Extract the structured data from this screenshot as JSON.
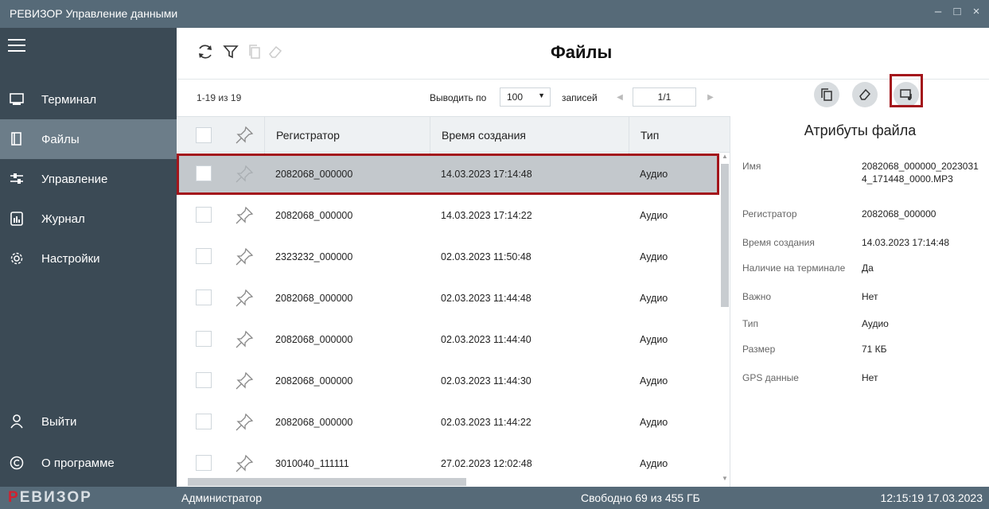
{
  "window": {
    "title": "РЕВИЗОР Управление данными",
    "min": "–",
    "max": "□",
    "close": "×"
  },
  "sidebar": {
    "items": [
      {
        "label": "Терминал",
        "icon": "terminal-icon"
      },
      {
        "label": "Файлы",
        "icon": "files-icon",
        "active": true
      },
      {
        "label": "Управление",
        "icon": "sliders-icon"
      },
      {
        "label": "Журнал",
        "icon": "journal-icon"
      },
      {
        "label": "Настройки",
        "icon": "gear-icon"
      }
    ],
    "bottom": [
      {
        "label": "Выйти",
        "icon": "user-icon"
      },
      {
        "label": "О программе",
        "icon": "copyright-icon"
      }
    ]
  },
  "toolbar": {
    "title": "Файлы"
  },
  "list": {
    "count": "1-19 из 19",
    "per_page_label": "Выводить по",
    "per_page_value": "100",
    "records_label": "записей",
    "page": "1/1",
    "columns": [
      "Регистратор",
      "Время создания",
      "Тип"
    ],
    "rows": [
      {
        "recorder": "2082068_000000",
        "time": "14.03.2023 17:14:48",
        "type": "Аудио",
        "selected": true
      },
      {
        "recorder": "2082068_000000",
        "time": "14.03.2023 17:14:22",
        "type": "Аудио"
      },
      {
        "recorder": "2323232_000000",
        "time": "02.03.2023 11:50:48",
        "type": "Аудио"
      },
      {
        "recorder": "2082068_000000",
        "time": "02.03.2023 11:44:48",
        "type": "Аудио"
      },
      {
        "recorder": "2082068_000000",
        "time": "02.03.2023 11:44:40",
        "type": "Аудио"
      },
      {
        "recorder": "2082068_000000",
        "time": "02.03.2023 11:44:30",
        "type": "Аудио"
      },
      {
        "recorder": "2082068_000000",
        "time": "02.03.2023 11:44:22",
        "type": "Аудио"
      },
      {
        "recorder": "3010040_111111",
        "time": "27.02.2023 12:02:48",
        "type": "Аудио"
      }
    ]
  },
  "panel": {
    "title": "Атрибуты файла",
    "attrs": [
      {
        "key": "Имя",
        "value": "2082068_000000_20230314_171448_0000.MP3"
      },
      {
        "key": "Регистратор",
        "value": "2082068_000000"
      },
      {
        "key": "Время создания",
        "value": "14.03.2023 17:14:48"
      },
      {
        "key": "Наличие на терминале",
        "value": "Да"
      },
      {
        "key": "Важно",
        "value": "Нет"
      },
      {
        "key": "Тип",
        "value": "Аудио"
      },
      {
        "key": "Размер",
        "value": "71 КБ"
      },
      {
        "key": "GPS данные",
        "value": "Нет"
      }
    ]
  },
  "footer": {
    "logo_first": "Р",
    "logo_rest": "ЕВИЗОР",
    "user": "Администратор",
    "free_space": "Свободно 69 из 455 ГБ",
    "clock": "12:15:19 17.03.2023"
  },
  "colors": {
    "sidebar": "#3b4a55",
    "sidebar_active": "#6c7d89",
    "titlebar": "#566a78",
    "highlight": "#a3151b",
    "selected_row": "#c3c8cc"
  }
}
